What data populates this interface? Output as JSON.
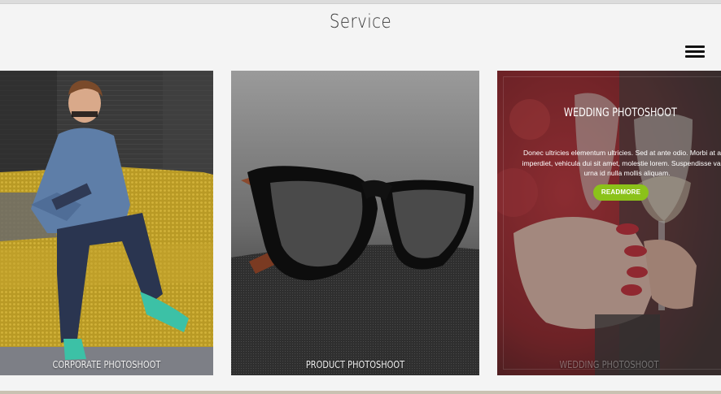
{
  "section": {
    "title": "Service"
  },
  "header": {
    "menu_icon": "hamburger-menu-icon"
  },
  "services": [
    {
      "label": "CORPORATE PHOTOSHOOT",
      "image": "man-sitting-on-yellow-couch-writing"
    },
    {
      "label": "PRODUCT PHOTOSHOOT",
      "image": "black-eyeglasses-on-carpet"
    },
    {
      "label": "WEDDING PHOTOSHOOT",
      "image": "hands-holding-champagne-glasses",
      "overlay": {
        "title": "WEDDING PHOTOSHOOT",
        "description_lines": [
          "Donec ultricies elementum ultricies. Sed at ante odio. Morbi at arcu",
          "imperdiet, vehicula dui sit amet, molestie lorem. Suspendisse varius",
          "urna id nulla mollis aliquam."
        ],
        "button_label": "READMORE"
      }
    }
  ],
  "colors": {
    "background": "#f4f4f4",
    "accent_button": "#8bc21a",
    "title_text": "#333333"
  }
}
